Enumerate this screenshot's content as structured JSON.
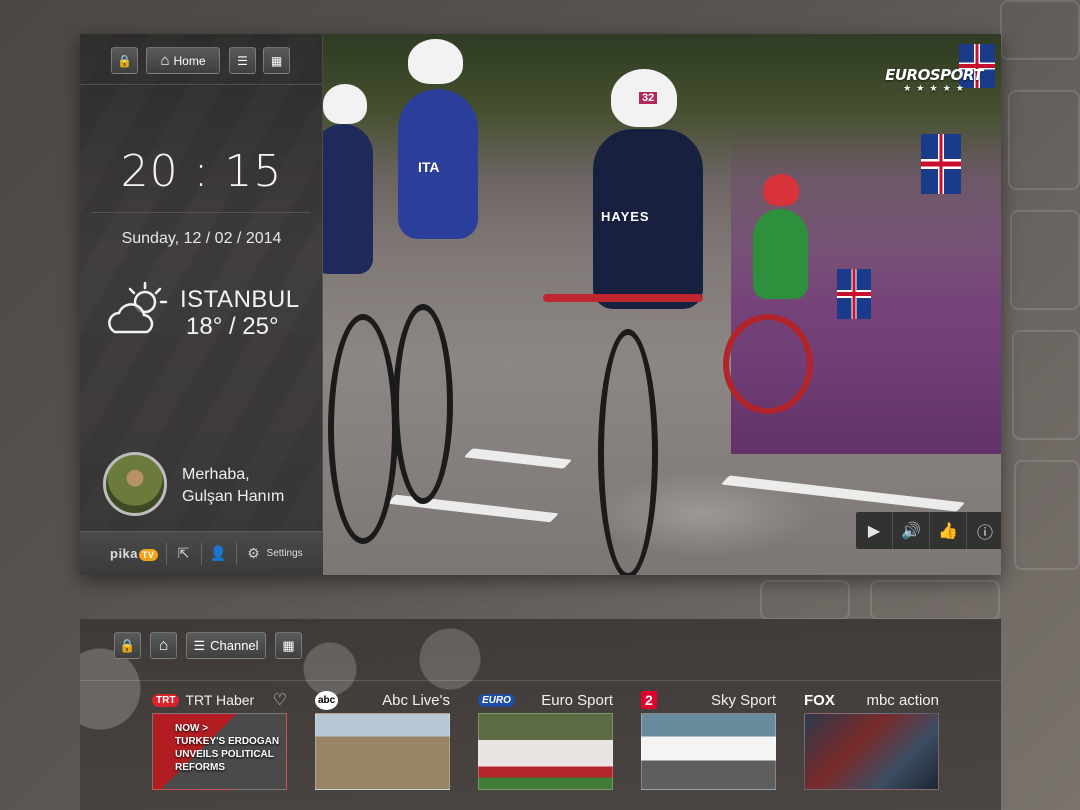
{
  "top": {
    "toolbar": {
      "home_label": "Home"
    },
    "clock": "20 : 15",
    "date": "Sunday, 12 / 02 / 2014",
    "weather": {
      "city": "ISTANBUL",
      "temp": "18° / 25°"
    },
    "greeting": {
      "line1": "Merhaba,",
      "line2": "Gulşan Hanım"
    },
    "footer": {
      "logo_text": "pika",
      "logo_badge": "TV",
      "settings_label": "Settings"
    },
    "video": {
      "channel_logo": "EUROSPORT",
      "jersey_name": "HAYES",
      "jersey_number": "32",
      "rival_team": "ITA"
    }
  },
  "bottom": {
    "toolbar": {
      "channel_label": "Channel"
    },
    "channels": [
      {
        "logo": "TRT",
        "name": "TRT Haber",
        "logo_color": "#d9232a",
        "thumb_text": "NOW >\nTURKEY'S ERDOGAN\nUNVEILS POLITICAL\nREFORMS"
      },
      {
        "logo": "abc",
        "name": "Abc Live's",
        "logo_color": "#ffffff"
      },
      {
        "logo": "EURO",
        "name": "Euro Sport",
        "logo_color": "#1e4fa3"
      },
      {
        "logo": "2",
        "name": "Sky Sport",
        "logo_color": "#e4002b"
      },
      {
        "logo": "FOX",
        "name": "mbc action",
        "logo_color": "#ffffff"
      }
    ]
  }
}
